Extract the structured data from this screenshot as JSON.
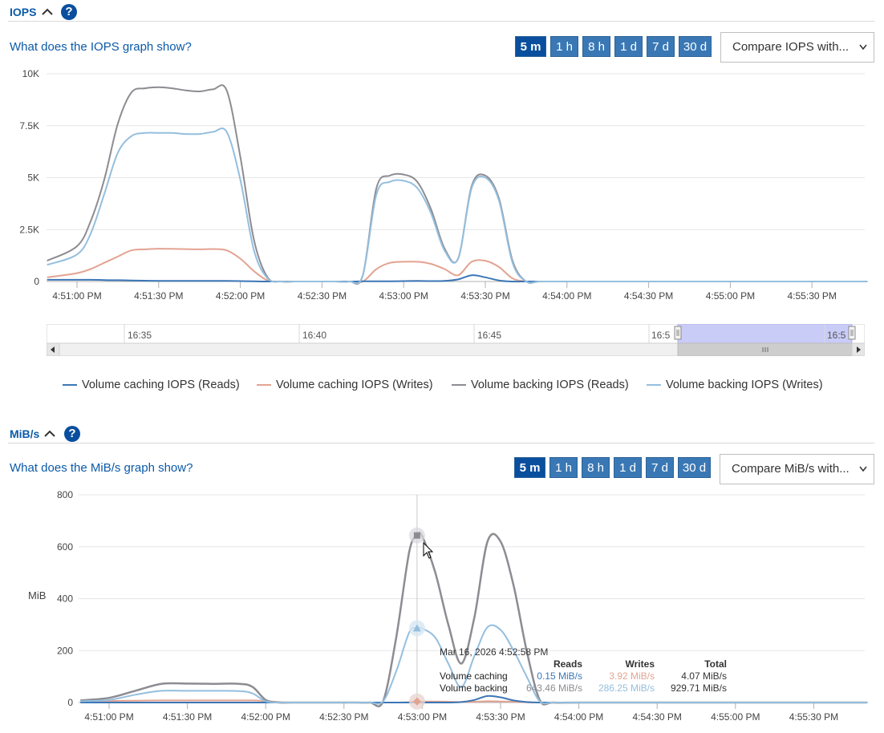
{
  "iops": {
    "title": "IOPS",
    "help_link": "What does the IOPS graph show?",
    "time_buttons": [
      "5 m",
      "1 h",
      "8 h",
      "1 d",
      "7 d",
      "30 d"
    ],
    "active_time": "5 m",
    "compare_select": "Compare IOPS with...",
    "chart_data": {
      "type": "line",
      "title": "",
      "ylabel": "",
      "ylim": [
        0,
        10000
      ],
      "y_ticks": [
        "0",
        "2.5K",
        "5K",
        "7.5K",
        "10K"
      ],
      "x_ticks": [
        "4:51:00 PM",
        "4:51:30 PM",
        "4:52:00 PM",
        "4:52:30 PM",
        "4:53:00 PM",
        "4:53:30 PM",
        "4:54:00 PM",
        "4:54:30 PM",
        "4:55:00 PM",
        "4:55:30 PM"
      ],
      "x_seconds": [
        -11,
        0,
        5,
        10,
        15,
        20,
        25,
        30,
        35,
        40,
        45,
        50,
        55,
        60,
        65,
        70,
        75,
        80,
        85,
        90,
        95,
        100,
        105,
        110,
        115,
        120,
        125,
        130,
        135,
        140,
        145,
        150,
        155,
        160,
        165,
        170,
        180,
        200,
        240,
        280,
        300,
        311
      ],
      "series": [
        {
          "name": "Volume caching IOPS (Reads)",
          "color": "#3b76b6",
          "values": [
            80,
            80,
            80,
            70,
            60,
            50,
            40,
            30,
            30,
            30,
            30,
            30,
            30,
            20,
            10,
            0,
            0,
            0,
            0,
            0,
            0,
            0,
            10,
            10,
            10,
            20,
            30,
            20,
            30,
            100,
            300,
            200,
            50,
            0,
            0,
            0,
            0,
            0,
            0,
            0,
            0,
            0
          ]
        },
        {
          "name": "Volume caching IOPS (Writes)",
          "color": "#e3a391",
          "values": [
            200,
            400,
            600,
            900,
            1200,
            1500,
            1550,
            1580,
            1570,
            1560,
            1550,
            1560,
            1500,
            1100,
            500,
            50,
            0,
            0,
            0,
            0,
            0,
            0,
            0,
            600,
            900,
            950,
            950,
            850,
            600,
            300,
            950,
            1000,
            700,
            150,
            0,
            0,
            0,
            0,
            0,
            0,
            0,
            0
          ]
        },
        {
          "name": "Volume backing IOPS (Reads)",
          "color": "#8c8c92",
          "values": [
            1000,
            1700,
            2900,
            4900,
            7600,
            9100,
            9300,
            9350,
            9300,
            9200,
            9150,
            9250,
            9200,
            6000,
            2000,
            200,
            0,
            0,
            0,
            0,
            0,
            0,
            300,
            4500,
            5100,
            5150,
            4800,
            3500,
            1600,
            1100,
            4600,
            5100,
            4000,
            1000,
            0,
            0,
            0,
            0,
            0,
            0,
            0,
            0
          ]
        },
        {
          "name": "Volume backing IOPS (Writes)",
          "color": "#94bfde",
          "values": [
            800,
            1300,
            2300,
            4200,
            6200,
            7000,
            7150,
            7150,
            7150,
            7100,
            7100,
            7200,
            7200,
            4900,
            1500,
            150,
            0,
            0,
            0,
            0,
            0,
            0,
            300,
            4200,
            4800,
            4850,
            4500,
            3300,
            1500,
            1100,
            4500,
            5000,
            3900,
            900,
            0,
            0,
            0,
            0,
            0,
            0,
            0,
            0
          ]
        }
      ]
    },
    "navigator": {
      "labels": [
        "16:35",
        "16:40",
        "16:45",
        "16:5",
        "16:5"
      ]
    },
    "legend": [
      {
        "label": "Volume caching IOPS (Reads)",
        "color": "#3b76b6"
      },
      {
        "label": "Volume caching IOPS (Writes)",
        "color": "#e3a391"
      },
      {
        "label": "Volume backing IOPS (Reads)",
        "color": "#8c8c92"
      },
      {
        "label": "Volume backing IOPS (Writes)",
        "color": "#94bfde"
      }
    ]
  },
  "mibs": {
    "title": "MiB/s",
    "help_link": "What does the MiB/s graph show?",
    "time_buttons": [
      "5 m",
      "1 h",
      "8 h",
      "1 d",
      "7 d",
      "30 d"
    ],
    "active_time": "5 m",
    "compare_select": "Compare MiB/s with...",
    "chart_data": {
      "type": "line",
      "title": "",
      "ylabel": "MiB",
      "ylim": [
        0,
        800
      ],
      "y_ticks": [
        "0",
        "200",
        "400",
        "600",
        "800"
      ],
      "x_ticks": [
        "4:51:00 PM",
        "4:51:30 PM",
        "4:52:00 PM",
        "4:52:30 PM",
        "4:53:00 PM",
        "4:53:30 PM",
        "4:54:00 PM",
        "4:54:30 PM",
        "4:55:00 PM",
        "4:55:30 PM"
      ],
      "x_seconds": [
        -11,
        0,
        10,
        20,
        30,
        40,
        50,
        55,
        60,
        65,
        70,
        80,
        90,
        95,
        100,
        105,
        110,
        115,
        118,
        120,
        125,
        130,
        135,
        140,
        145,
        150,
        155,
        160,
        165,
        170,
        180,
        200,
        240,
        280,
        300,
        311
      ],
      "series": [
        {
          "name": "Volume caching",
          "color": "#3b76b6",
          "values": [
            0,
            0,
            0,
            0,
            0,
            0,
            0,
            0,
            0,
            0,
            0,
            0,
            0,
            0,
            0,
            0,
            0,
            0,
            0.15,
            0,
            0,
            0,
            2,
            10,
            25,
            20,
            8,
            2,
            0,
            0,
            0,
            0,
            0,
            0,
            0,
            0
          ]
        },
        {
          "name": "Volume caching (Writes)",
          "color": "#e3a391",
          "values": [
            5,
            6,
            7,
            8,
            8,
            8,
            8,
            8,
            6,
            2,
            0,
            0,
            0,
            0,
            0,
            0,
            0,
            2,
            3.92,
            4,
            4,
            3,
            2,
            3,
            5,
            4,
            3,
            1,
            0,
            0,
            0,
            0,
            0,
            0,
            0,
            0
          ]
        },
        {
          "name": "Volume backing",
          "color": "#8c8c92",
          "values": [
            8,
            18,
            45,
            72,
            73,
            72,
            72,
            60,
            10,
            0,
            0,
            0,
            0,
            0,
            0,
            5,
            250,
            580,
            643.46,
            640,
            500,
            300,
            150,
            330,
            620,
            620,
            450,
            200,
            10,
            0,
            0,
            0,
            0,
            0,
            0,
            0
          ]
        },
        {
          "name": "Volume backing (Writes)",
          "color": "#94bfde",
          "values": [
            5,
            10,
            30,
            45,
            45,
            45,
            44,
            35,
            5,
            0,
            0,
            0,
            0,
            0,
            0,
            5,
            120,
            270,
            286.25,
            285,
            250,
            150,
            60,
            180,
            290,
            280,
            200,
            100,
            5,
            0,
            0,
            0,
            0,
            0,
            0,
            0
          ]
        }
      ]
    },
    "tooltip": {
      "date": "Mar 16, 2026 4:52:58 PM",
      "headers": [
        "Reads",
        "Writes",
        "Total"
      ],
      "rows": [
        {
          "label": "Volume caching",
          "reads": "0.15 MiB/s",
          "writes": "3.92 MiB/s",
          "total": "4.07 MiB/s"
        },
        {
          "label": "Volume backing",
          "reads": "643.46 MiB/s",
          "writes": "286.25 MiB/s",
          "total": "929.71 MiB/s"
        }
      ]
    }
  }
}
